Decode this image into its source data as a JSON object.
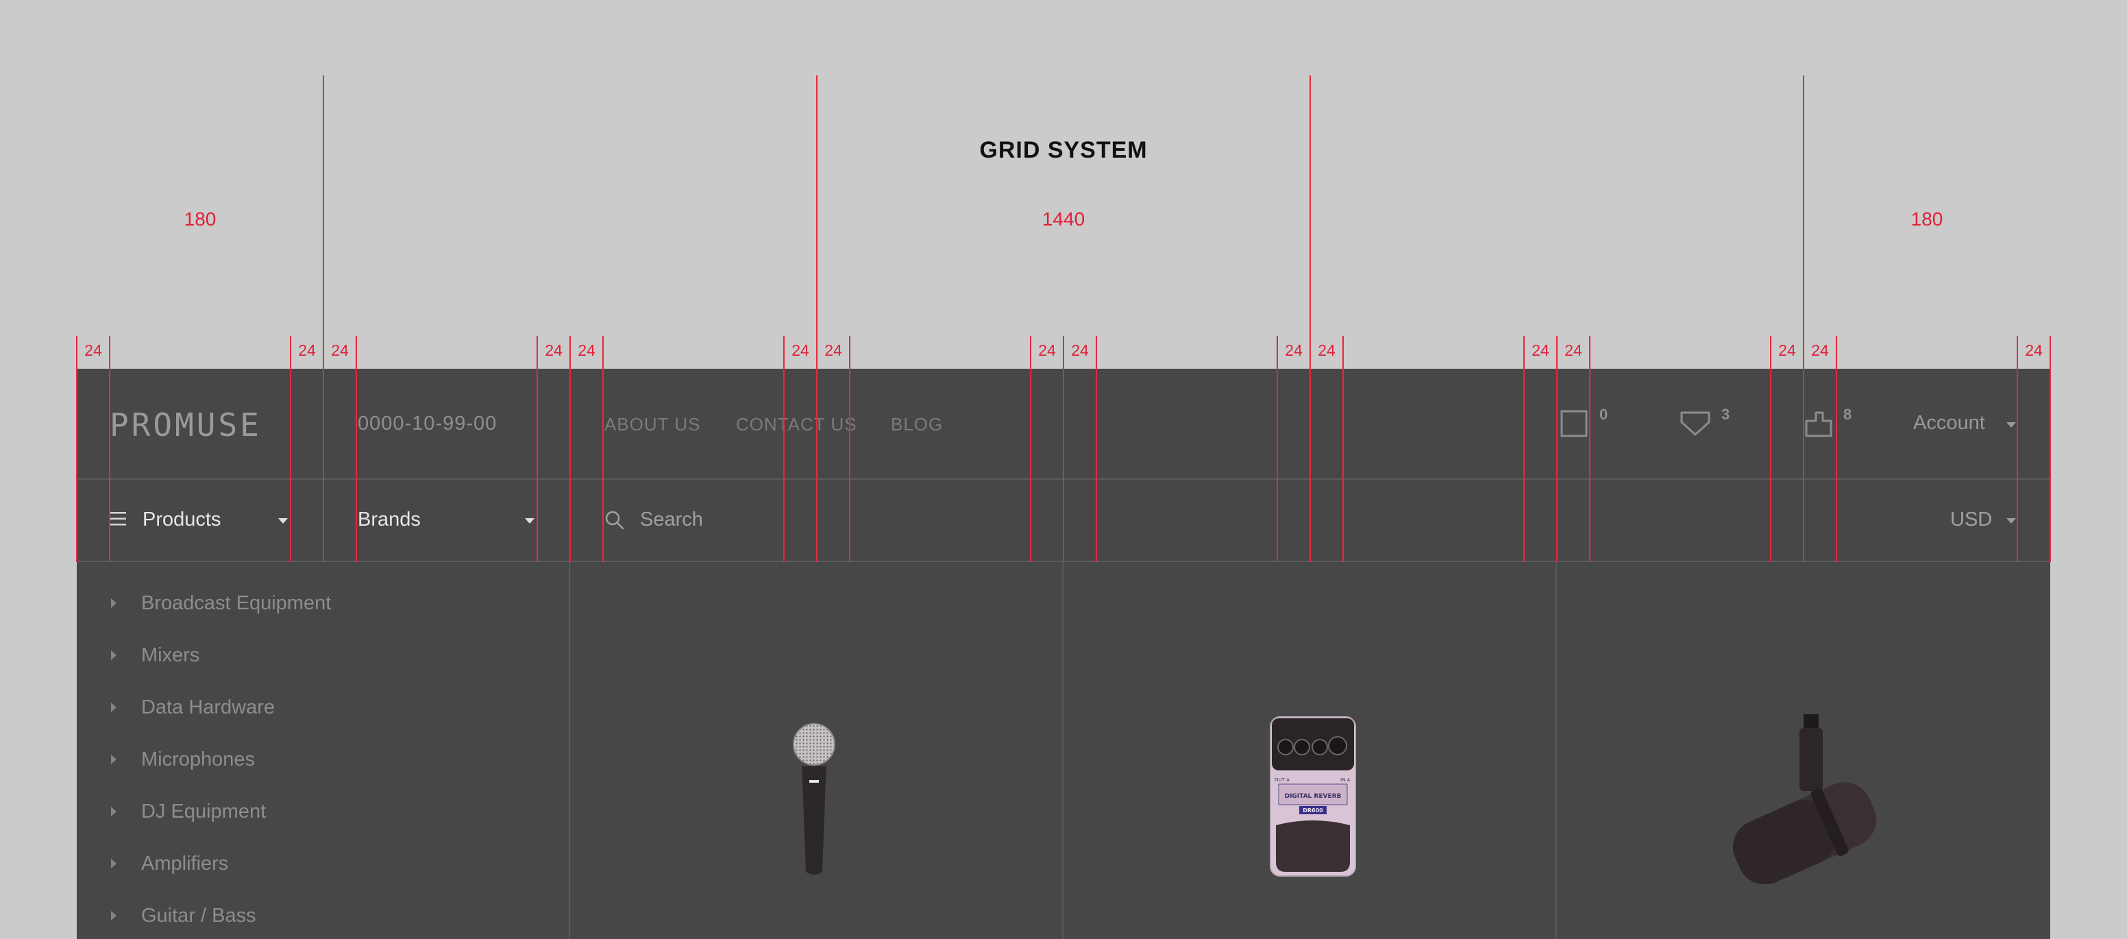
{
  "page": {
    "title": "GRID SYSTEM",
    "zones": [
      "180",
      "1440",
      "180"
    ],
    "gutter_label": "24"
  },
  "header": {
    "logo_text": "PROMUSE",
    "phone": "0000-10-99-00",
    "nav": [
      "ABOUT US",
      "CONTACT US",
      "BLOG"
    ],
    "compare_count": "0",
    "wishlist_count": "3",
    "cart_count": "8",
    "account_label": "Account"
  },
  "toolbar": {
    "products_label": "Products",
    "brands_label": "Brands",
    "search_placeholder": "Search",
    "currency": "USD"
  },
  "sidebar": {
    "categories": [
      "Broadcast Equipment",
      "Mixers",
      "Data Hardware",
      "Microphones",
      "DJ Equipment",
      "Amplifiers",
      "Guitar / Bass"
    ]
  },
  "products": [
    {
      "name": "microphone"
    },
    {
      "name": "guitar pedal",
      "label_top": "DIGITAL REVERB",
      "label_model": "DR600",
      "label_left": "OUT A",
      "label_right": "IN A"
    },
    {
      "name": "studio microphone"
    }
  ],
  "colors": {
    "grid_line": "#e42a3d",
    "app_bg": "#474747",
    "page_bg": "#cbcbcb"
  }
}
